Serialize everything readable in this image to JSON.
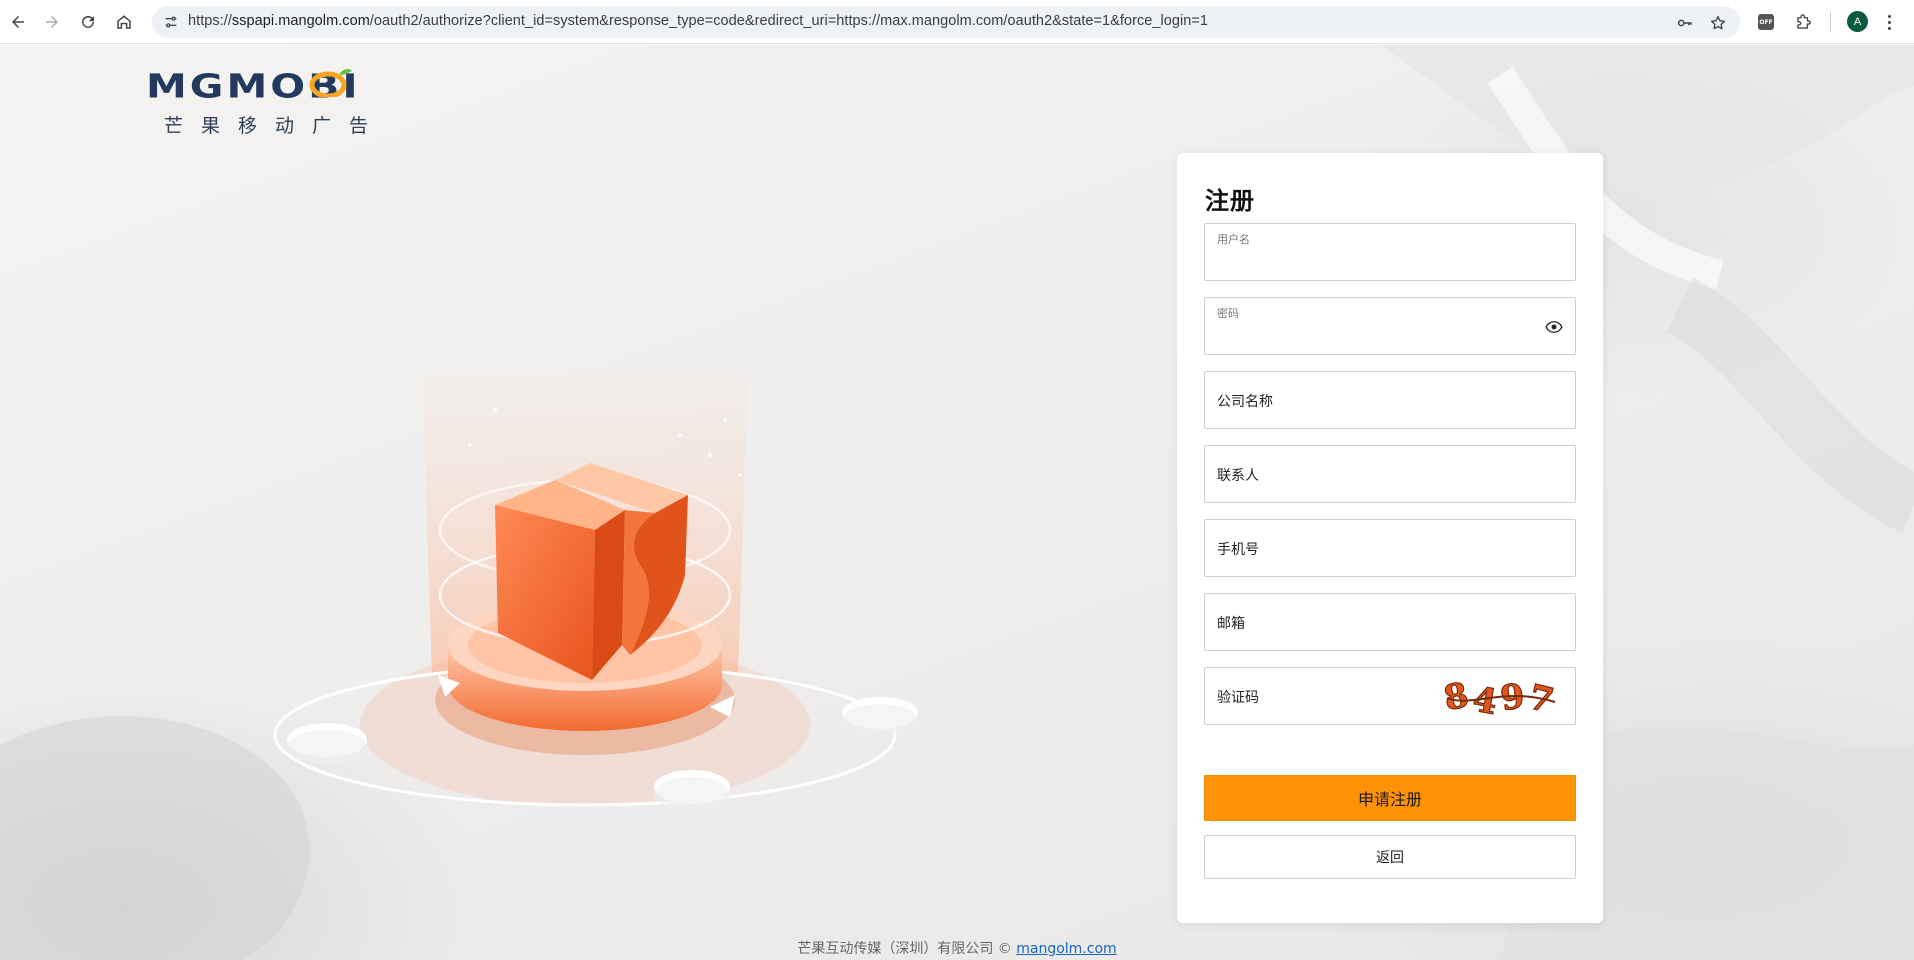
{
  "browser": {
    "url_prefix": "https://",
    "url_host": "sspapi.mangolm.com",
    "url_path": "/oauth2/authorize?client_id=system&response_type=code&redirect_uri=https://max.mangolm.com/oauth2&state=1&force_login=1",
    "extension_off_label": "OFF",
    "profile_initial": "A"
  },
  "logo": {
    "brand": "MGMOBI",
    "subtitle": "芒果移动广告"
  },
  "form": {
    "title": "注册",
    "fields": {
      "username_label": "用户名",
      "password_label": "密码",
      "company_placeholder": "公司名称",
      "contact_placeholder": "联系人",
      "phone_placeholder": "手机号",
      "email_placeholder": "邮箱",
      "captcha_placeholder": "验证码"
    },
    "captcha_text": "8497",
    "submit_label": "申请注册",
    "back_label": "返回"
  },
  "footer": {
    "text": "芒果互动传媒（深圳）有限公司 © ",
    "link": "mangolm.com"
  },
  "colors": {
    "accent": "#ff9307",
    "brand_navy": "#233a5e",
    "hero_orange": "#f06a2c",
    "link": "#1565c0"
  }
}
